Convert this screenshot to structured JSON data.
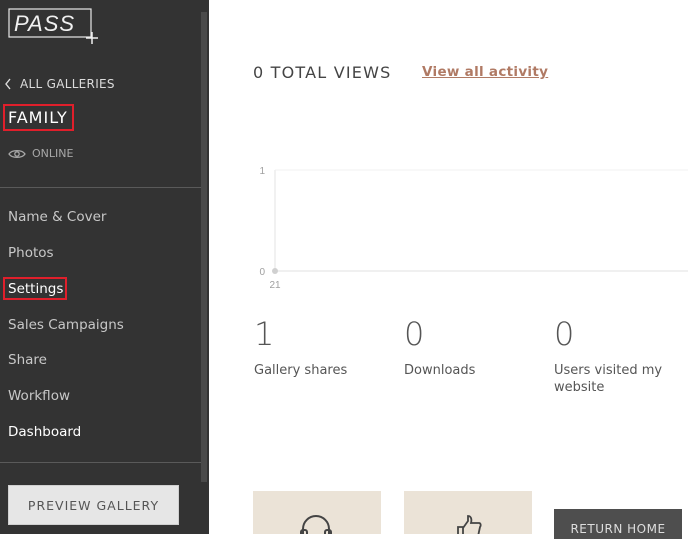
{
  "brand": {
    "logo_text": "PASS"
  },
  "sidebar": {
    "back_label": "ALL GALLERIES",
    "gallery_name": "FAMILY",
    "status": "ONLINE",
    "items": [
      {
        "label": "Name & Cover"
      },
      {
        "label": "Photos"
      },
      {
        "label": "Settings"
      },
      {
        "label": "Sales Campaigns"
      },
      {
        "label": "Share"
      },
      {
        "label": "Workflow"
      },
      {
        "label": "Dashboard"
      }
    ],
    "preview_button": "PREVIEW GALLERY"
  },
  "main": {
    "total_views": "0 TOTAL VIEWS",
    "view_activity_link": "View all activity",
    "stats": [
      {
        "value": "1",
        "label": "Gallery shares"
      },
      {
        "value": "0",
        "label": "Downloads"
      },
      {
        "value": "0",
        "label": "Users visited my website"
      }
    ],
    "cards": [
      {
        "icon": "headphones-icon"
      },
      {
        "icon": "thumbs-up-icon"
      }
    ],
    "return_button": "RETURN HOME"
  },
  "chart_data": {
    "type": "line",
    "x": [
      "21"
    ],
    "series": [
      {
        "values": [
          0
        ]
      }
    ],
    "ylim": [
      0,
      1
    ],
    "yticks": [
      "1",
      "0"
    ],
    "grid": true
  },
  "colors": {
    "sidebar_bg": "#333333",
    "highlight_border": "#e01f2b",
    "link": "#b07a64",
    "card_bg": "#ebe3d7",
    "return_button_bg": "#4e4e4e"
  }
}
